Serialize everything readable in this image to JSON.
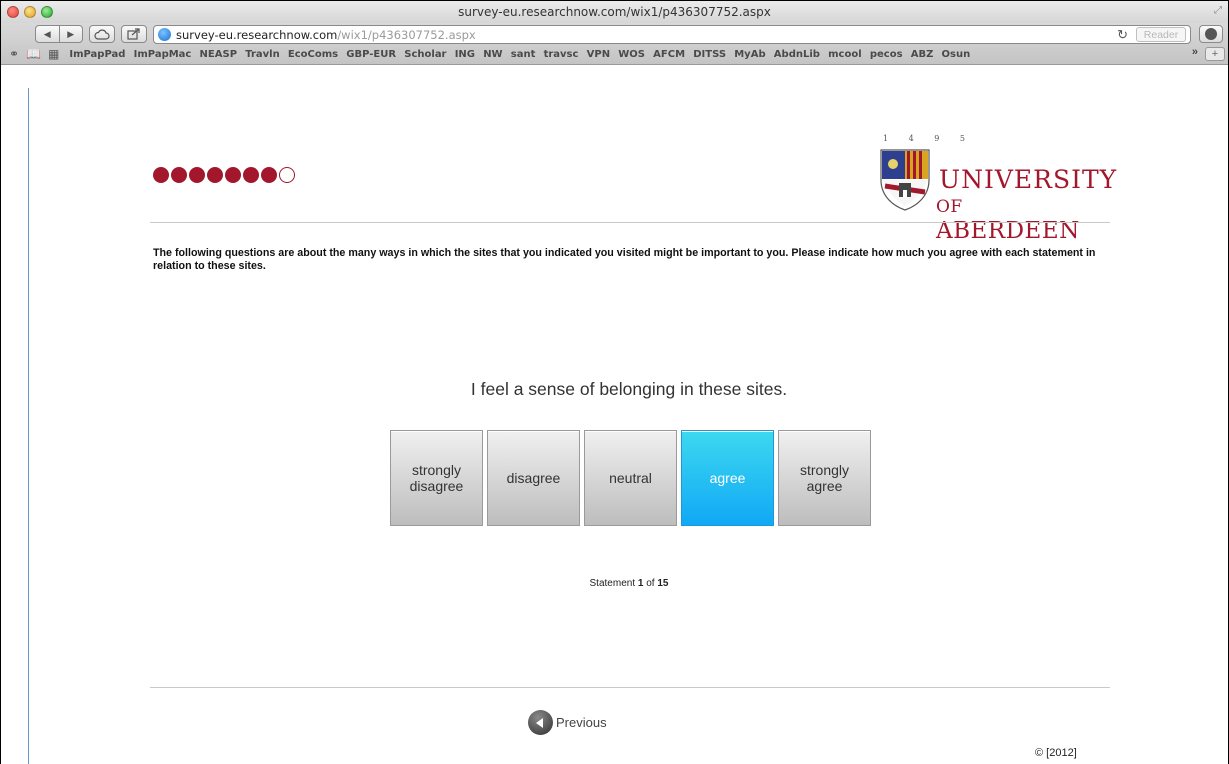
{
  "window": {
    "title": "survey-eu.researchnow.com/wix1/p436307752.aspx"
  },
  "toolbar": {
    "url_domain": "survey-eu.researchnow.com",
    "url_path": "/wix1/p436307752.aspx",
    "reader_label": "Reader",
    "reload_glyph": "↻",
    "back_glyph": "◀",
    "forward_glyph": "▶"
  },
  "bookmarks": {
    "items": [
      "ImPapPad",
      "ImPapMac",
      "NEASP",
      "Travln",
      "EcoComs",
      "GBP-EUR",
      "Scholar",
      "ING",
      "NW",
      "sant",
      "travsc",
      "VPN",
      "WOS",
      "AFCM",
      "DITSS",
      "MyAb",
      "AbdnLib",
      "mcool",
      "pecos",
      "ABZ",
      "Osun"
    ],
    "more_glyph": "»",
    "add_glyph": "+"
  },
  "progress": {
    "completed": 7,
    "total": 8
  },
  "logo": {
    "years": "1495",
    "line1": "UNIVERSITY",
    "line2_prefix": "OF",
    "line2_main": "ABERDEEN"
  },
  "survey": {
    "intro": "The following questions are about the many ways in which the sites that you indicated you visited might be important to you. Please indicate how much you agree with each statement in relation to these sites.",
    "question": "I feel a sense of belonging in these sites.",
    "options": [
      {
        "line1": "strongly",
        "line2": "disagree"
      },
      {
        "line1": "disagree",
        "line2": ""
      },
      {
        "line1": "neutral",
        "line2": ""
      },
      {
        "line1": "agree",
        "line2": ""
      },
      {
        "line1": "strongly",
        "line2": "agree"
      }
    ],
    "selected_option": "agree",
    "statement_label": "Statement",
    "statement_current": "1",
    "statement_of": "of",
    "statement_total": "15"
  },
  "footer": {
    "previous_label": "Previous",
    "copyright": "© [2012]"
  },
  "colors": {
    "brand_red": "#a3172d",
    "selected_blue": "#11a8f5"
  }
}
